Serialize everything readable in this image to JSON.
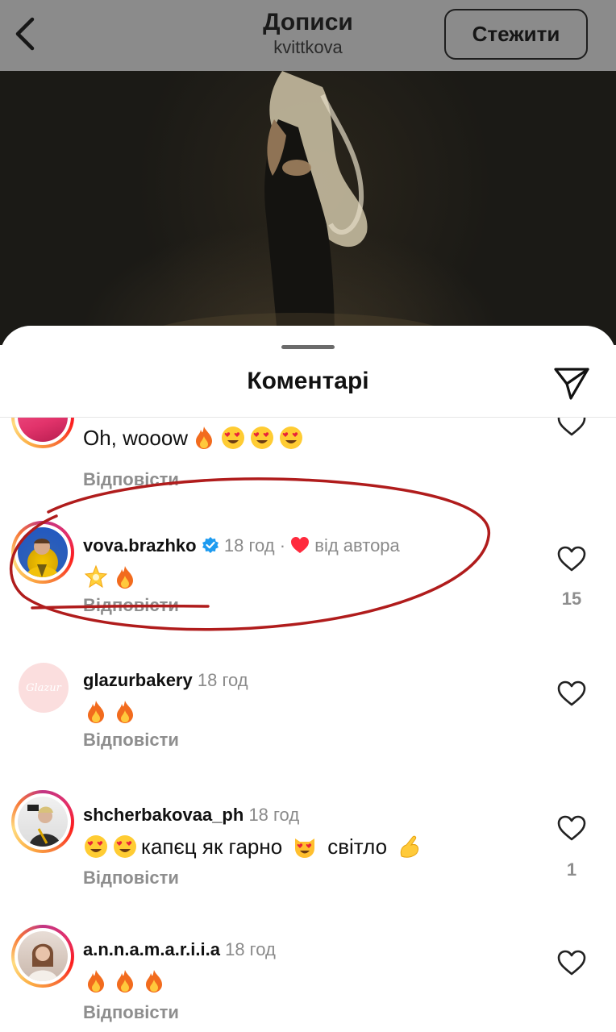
{
  "header": {
    "title": "Дописи",
    "subtitle": "kvittkova",
    "follow_label": "Стежити"
  },
  "sheet": {
    "title": "Коментарі"
  },
  "comments": [
    {
      "username": "",
      "meta": "",
      "text": "Oh, wooow",
      "emojis": [
        "fire",
        "heart-eyes",
        "heart-eyes",
        "heart-eyes"
      ],
      "reply_label": "Відповісти",
      "likes": ""
    },
    {
      "username": "vova.brazhko",
      "verified": true,
      "meta": "18 год",
      "author_like": "від автора",
      "text": "",
      "emojis": [
        "glowing-star",
        "fire"
      ],
      "reply_label": "Відповісти",
      "likes": "15"
    },
    {
      "username": "glazurbakery",
      "meta": "18 год",
      "text": "",
      "emojis": [
        "fire",
        "fire"
      ],
      "reply_label": "Відповісти",
      "likes": "",
      "avatar_text": "Glazur"
    },
    {
      "username": "shcherbakovaa_ph",
      "meta": "18 год",
      "text_parts": [
        "капєц як гарно",
        "світло"
      ],
      "emojis": [
        "heart-eyes",
        "heart-eyes",
        "heart-eyes-cat",
        "pinching-hand"
      ],
      "reply_label": "Відповісти",
      "likes": "1"
    },
    {
      "username": "a.n.n.a.m.a.r.i.i.a",
      "meta": "18 год",
      "text": "",
      "emojis": [
        "fire",
        "fire",
        "fire"
      ],
      "reply_label": "Відповісти",
      "likes": ""
    }
  ],
  "colors": {
    "accent_red_annotation": "#b01c1c",
    "verified_blue": "#1d9bf0",
    "muted_gray": "#8e8e8e"
  }
}
